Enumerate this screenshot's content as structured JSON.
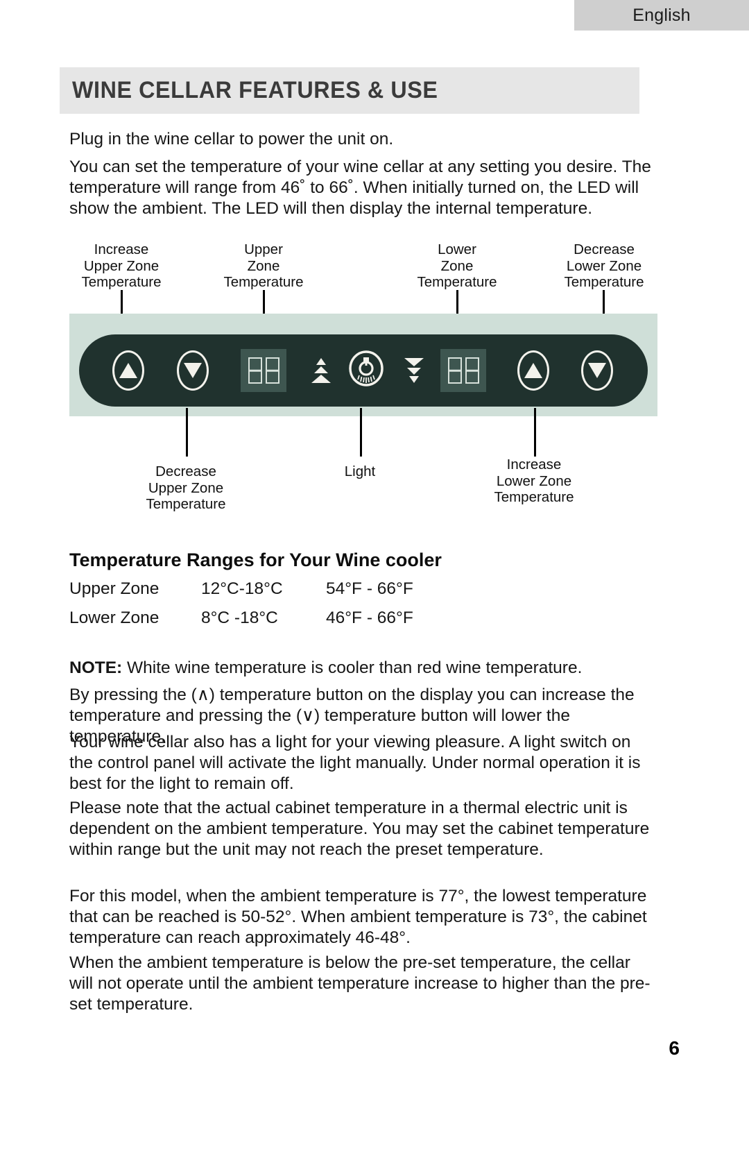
{
  "header": {
    "language_tab": "English"
  },
  "section": {
    "title": "WINE CELLAR FEATURES & USE"
  },
  "intro": {
    "paragraph1": "Plug in the wine cellar to power the unit on.",
    "paragraph2": "You can set the temperature of your wine cellar at any setting you desire. The temperature will range from 46˚ to 66˚. When initially turned on, the LED will show the ambient. The LED will then display the internal temperature."
  },
  "control_panel": {
    "top_callouts": [
      {
        "label": "Increase\nUpper Zone\nTemperature"
      },
      {
        "label": "Upper\nZone\nTemperature"
      },
      {
        "label": "Lower\nZone\nTemperature"
      },
      {
        "label": "Decrease\nLower Zone\nTemperature"
      }
    ],
    "bottom_callouts": [
      {
        "label": "Decrease\nUpper Zone\nTemperature"
      },
      {
        "label": "Light"
      },
      {
        "label": "Increase\nLower Zone\nTemperature"
      }
    ],
    "colors": {
      "panel_body": "#20322e",
      "panel_band": "#cfdfd8",
      "led_background": "#3e5650",
      "icon_light": "#f3f2ec"
    }
  },
  "temperature_ranges": {
    "heading": "Temperature Ranges for Your Wine cooler",
    "rows": [
      {
        "zone": "Upper Zone",
        "celsius": "12°C-18°C",
        "fahrenheit": "54°F - 66°F"
      },
      {
        "zone": "Lower Zone",
        "celsius": "8°C  -18°C",
        "fahrenheit": "46°F - 66°F"
      }
    ]
  },
  "notes": {
    "note_label": "NOTE:",
    "note_text": " White wine temperature is cooler than red wine temperature.",
    "paragraph_buttons": "By pressing the (∧) temperature button on the display you can increase the temperature and pressing the (∨) temperature button will lower the temperature.",
    "paragraph_light": "Your wine cellar also has a light for your viewing pleasure. A light switch on the control panel will activate the light manually. Under normal operation it is best for the light to remain off.",
    "paragraph_thermal": "Please note that the actual cabinet temperature in a thermal electric unit is dependent on the ambient temperature. You may set the cabinet temperature within range but the unit may not reach the preset temperature.",
    "paragraph_model": "For this model, when the ambient temperature is 77°, the lowest temperature that can be reached is 50-52°. When ambient temperature is 73°, the cabinet temperature can reach approximately 46-48°.",
    "paragraph_below_preset": "When the ambient temperature is below the pre-set temperature, the cellar will not operate until the ambient temperature increase to higher than the pre-set temperature."
  },
  "footer": {
    "page_number": "6"
  }
}
